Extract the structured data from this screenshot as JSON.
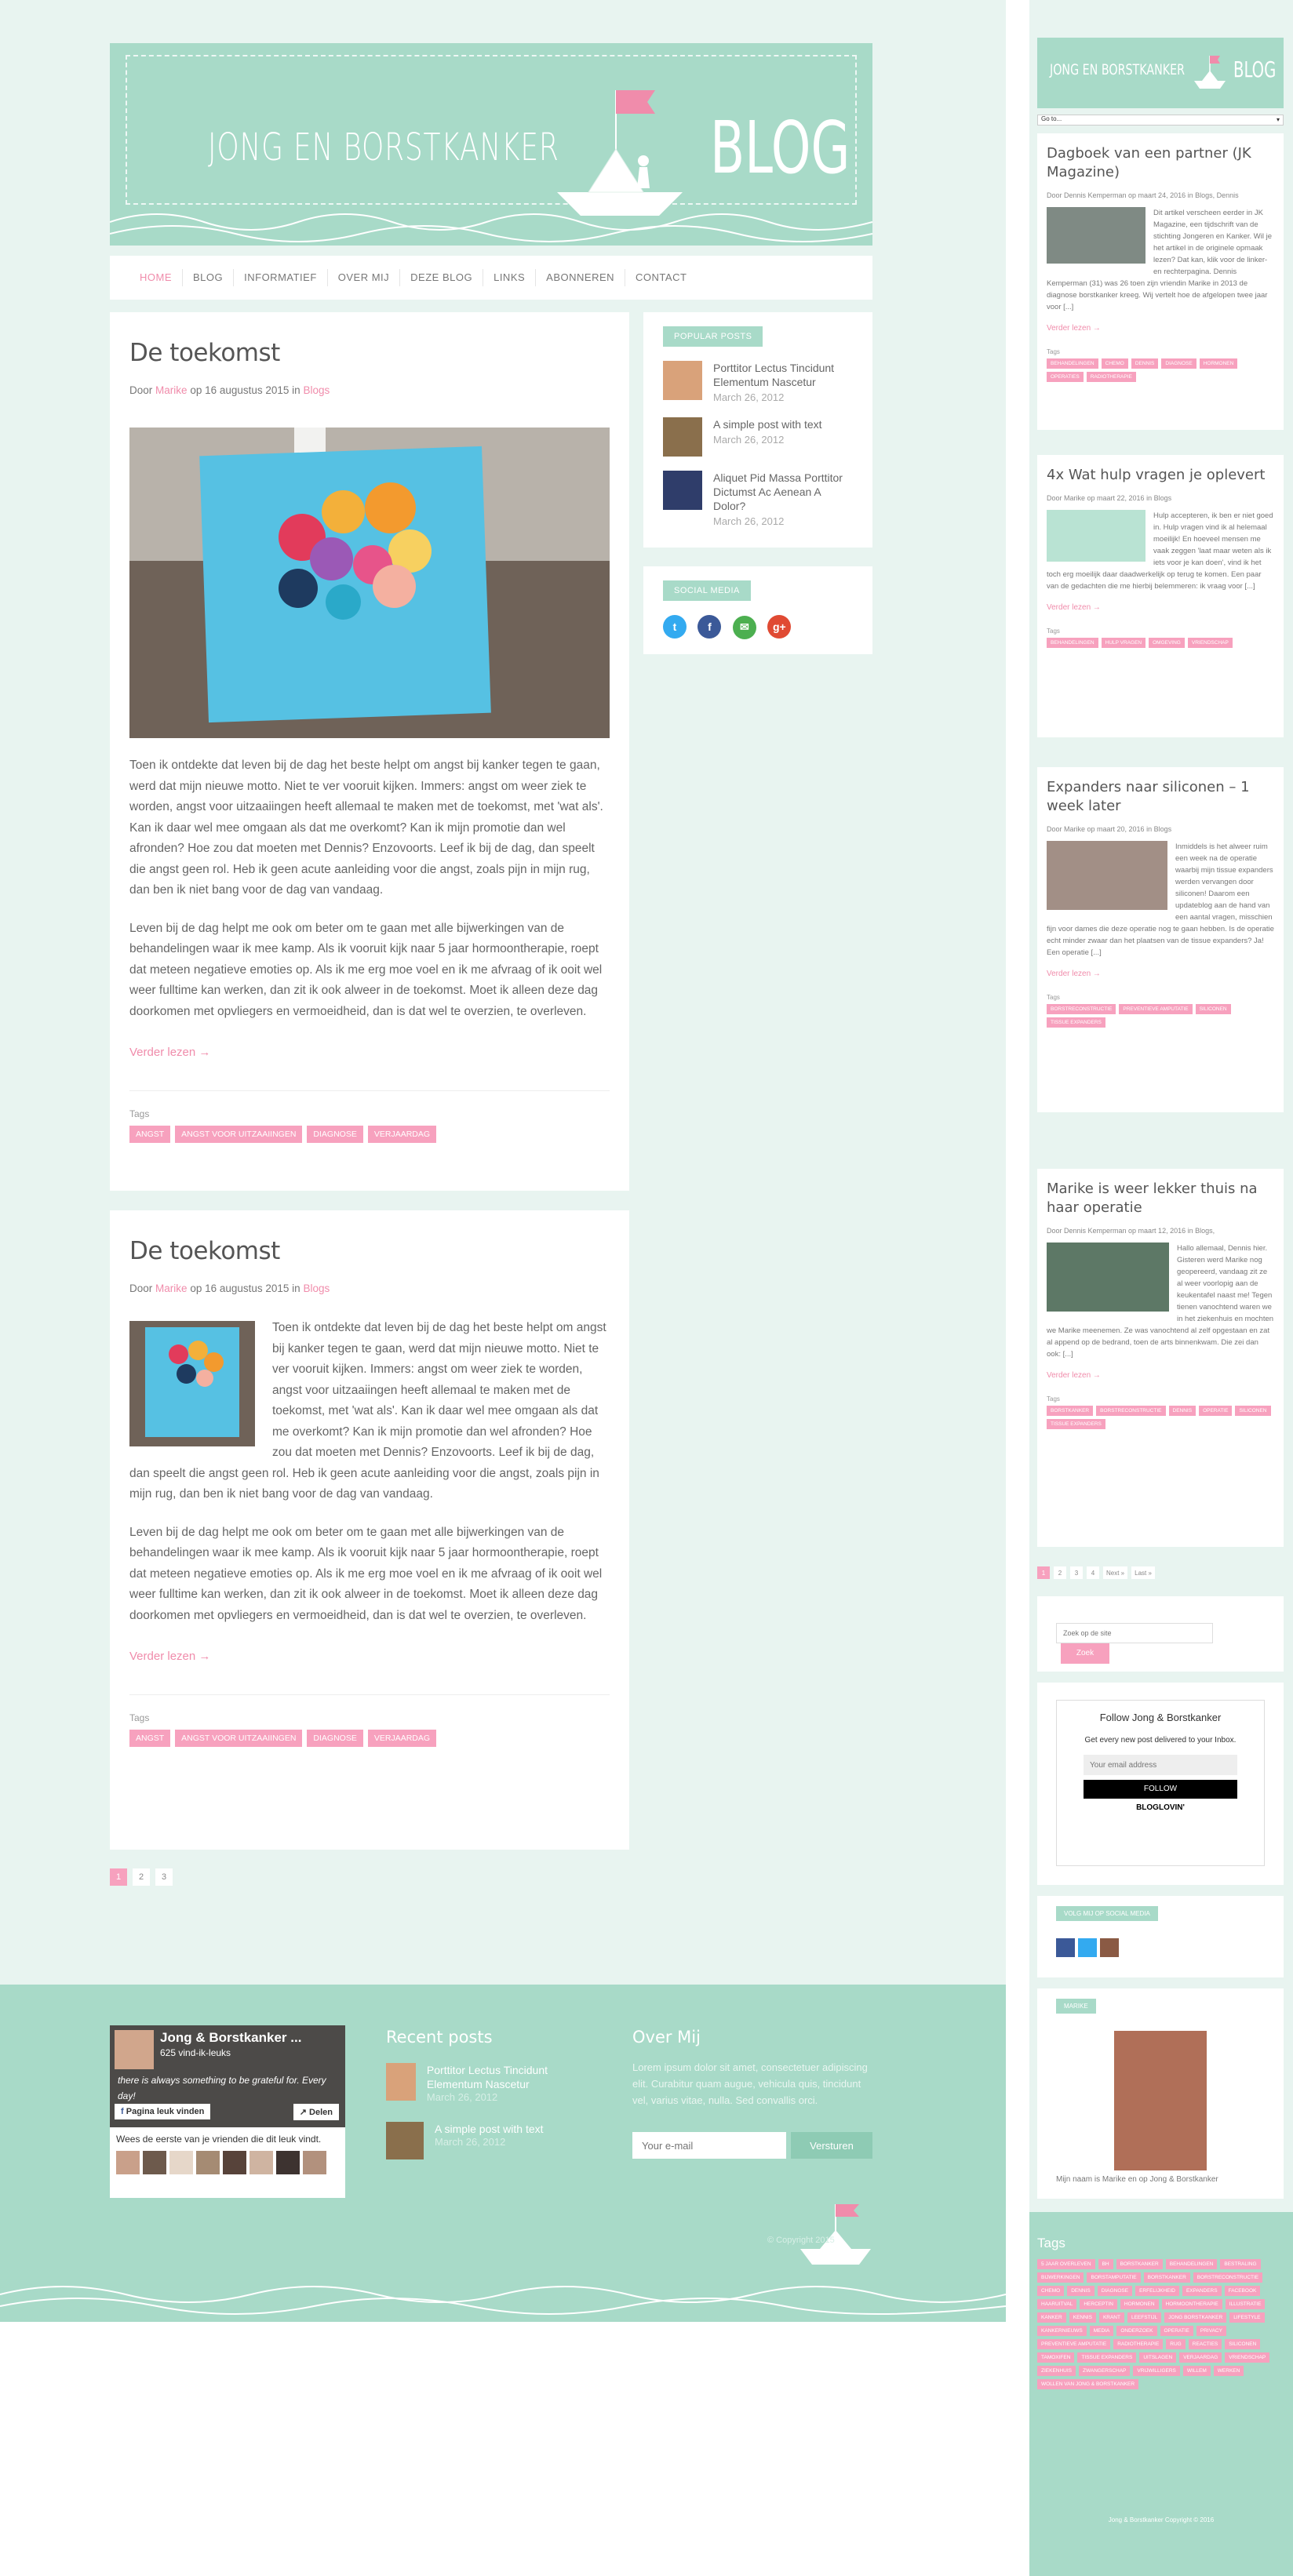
{
  "header": {
    "title": "JONG EN BORSTKANKER",
    "blog": "BLOG"
  },
  "nav": {
    "items": [
      "HOME",
      "BLOG",
      "INFORMATIEF",
      "OVER MIJ",
      "DEZE BLOG",
      "LINKS",
      "ABONNEREN",
      "CONTACT"
    ]
  },
  "posts": [
    {
      "title": "De toekomst",
      "meta_prefix": "Door",
      "author": "Marike",
      "meta_date": "op 16 augustus 2015 in",
      "category": "Blogs",
      "para1": "Toen ik ontdekte dat leven bij de dag het beste helpt om angst bij kanker tegen te gaan, werd dat mijn nieuwe motto. Niet te ver vooruit kijken. Immers: angst om weer ziek te worden, angst voor uitzaaiingen heeft allemaal te maken met de toekomst, met 'wat als'. Kan ik daar wel mee omgaan als dat me overkomt? Kan ik mijn promotie dan wel afronden? Hoe zou dat moeten met Dennis? Enzovoorts. Leef ik bij de dag, dan speelt die angst geen rol. Heb ik geen acute aanleiding voor die angst, zoals pijn in mijn rug, dan ben ik niet bang voor de dag van vandaag.",
      "para2": "Leven bij de dag helpt me ook om beter om te gaan met alle bijwerkingen van de behandelingen waar ik mee kamp. Als ik vooruit kijk naar 5 jaar hormoontherapie, roept dat meteen negatieve emoties op. Als ik me erg moe voel en ik me afvraag of ik ooit wel weer fulltime kan werken, dan zit ik ook alweer in de toekomst. Moet ik alleen deze dag doorkomen met opvliegers en vermoeidheid, dan is dat wel te overzien, te overleven.",
      "readmore": "Verder lezen →",
      "tags_label": "Tags",
      "tags": [
        "ANGST",
        "ANGST VOOR UITZAAIINGEN",
        "DIAGNOSE",
        "VERJAARDAG"
      ]
    },
    {
      "title": "De toekomst",
      "meta_prefix": "Door",
      "author": "Marike",
      "meta_date": "op 16 augustus 2015 in",
      "category": "Blogs",
      "para1": "Toen ik ontdekte dat leven bij de dag het beste helpt om angst bij kanker tegen te gaan, werd dat mijn nieuwe motto. Niet te ver vooruit kijken. Immers: angst om weer ziek te worden, angst voor uitzaaiingen heeft allemaal te maken met de toekomst, met 'wat als'. Kan ik daar wel mee omgaan als dat me overkomt? Kan ik mijn promotie dan wel afronden? Hoe zou dat moeten met Dennis? Enzovoorts. Leef ik bij de dag, dan speelt die angst geen rol. Heb ik geen acute aanleiding voor die angst, zoals pijn in mijn rug, dan ben ik niet bang voor de dag van vandaag.",
      "para2": "Leven bij de dag helpt me ook om beter om te gaan met alle bijwerkingen van de behandelingen waar ik mee kamp. Als ik vooruit kijk naar 5 jaar hormoontherapie, roept dat meteen negatieve emoties op. Als ik me erg moe voel en ik me afvraag of ik ooit wel weer fulltime kan werken, dan zit ik ook alweer in de toekomst. Moet ik alleen deze dag doorkomen met opvliegers en vermoeidheid, dan is dat wel te overzien, te overleven.",
      "readmore": "Verder lezen →",
      "tags_label": "Tags",
      "tags": [
        "ANGST",
        "ANGST VOOR UITZAAIINGEN",
        "DIAGNOSE",
        "VERJAARDAG"
      ]
    }
  ],
  "pager": [
    "1",
    "2",
    "3"
  ],
  "popular": {
    "label": "POPULAR POSTS",
    "items": [
      {
        "title": "Porttitor Lectus Tincidunt Elementum Nascetur",
        "date": "March 26, 2012",
        "color": "#d9a27a"
      },
      {
        "title": "A simple post with text",
        "date": "March 26, 2012",
        "color": "#8a6f4c"
      },
      {
        "title": "Aliquet Pid Massa Porttitor Dictumst Ac Aenean A Dolor?",
        "date": "March 26, 2012",
        "color": "#2f3d6a"
      }
    ]
  },
  "social": {
    "label": "SOCIAL MEDIA",
    "icons": [
      {
        "name": "twitter-icon",
        "glyph": "t",
        "color": "#33aaf0"
      },
      {
        "name": "facebook-icon",
        "glyph": "f",
        "color": "#3b5998"
      },
      {
        "name": "email-icon",
        "glyph": "✉",
        "color": "#4caf50"
      },
      {
        "name": "googleplus-icon",
        "glyph": "g+",
        "color": "#e04a33"
      }
    ]
  },
  "footer": {
    "fb_name": "Jong & Borstkanker ...",
    "fb_likes": "625 vind-ik-leuks",
    "fb_quote": "there is always something to be grateful for. Every day!",
    "fb_like_btn": "Pagina leuk vinden",
    "fb_share": "Delen",
    "fb_friends": "Wees de eerste van je vrienden die dit leuk vindt.",
    "recent_title": "Recent posts",
    "recent": [
      {
        "title": "Porttitor Lectus Tincidunt Elementum Nascetur",
        "date": "March 26, 2012"
      },
      {
        "title": "A simple post with text",
        "date": "March 26, 2012"
      }
    ],
    "about_title": "Over Mij",
    "about_text": "Lorem ipsum dolor sit amet, consectetuer adipiscing elit. Curabitur quam augue, vehicula quis, tincidunt vel, varius vitae, nulla. Sed convallis orci.",
    "email_placeholder": "Your e-mail",
    "send": "Versturen",
    "copyright": "© Copyright 2015"
  },
  "right": {
    "goto": "Go to...",
    "cards": [
      {
        "title": "Dagboek van een partner (JK Magazine)",
        "meta": "Door Dennis Kemperman op maart 24, 2016 in Blogs, Dennis",
        "text": "Dit artikel verscheen eerder in JK Magazine, een tijdschrift van de stichting Jongeren en Kanker. Wil je het artikel in de originele opmaak lezen? Dat kan, klik voor de linker- en rechterpagina. Dennis Kemperman (31) was 26 toen zijn vriendin Marike in 2013 de diagnose borstkanker kreeg. Wij vertelt hoe de afgelopen twee jaar voor [...]",
        "tags": [
          "BEHANDELINGEN",
          "CHEMO",
          "DENNIS",
          "DIAGNOSE",
          "HORMONEN",
          "OPERATIES",
          "RADIOTHERAPIE"
        ]
      },
      {
        "title": "4x Wat hulp vragen je oplevert",
        "meta": "Door Marike op maart 22, 2016 in Blogs",
        "text": "Hulp accepteren, ik ben er niet goed in. Hulp vragen vind ik al helemaal moeilijk! En hoeveel mensen me vaak zeggen 'laat maar weten als ik iets voor je kan doen', vind ik het toch erg moeilijk daar daadwerkelijk op terug te komen. Een paar van de gedachten die me hierbij belemmeren: ik vraag voor [...]",
        "tags": [
          "BEHANDELINGEN",
          "HULP VRAGEN",
          "OMGEVING",
          "VRIENDSCHAP"
        ]
      },
      {
        "title": "Expanders naar siliconen – 1 week later",
        "meta": "Door Marike op maart 20, 2016 in Blogs",
        "text": "Inmiddels is het alweer ruim een week na de operatie waarbij mijn tissue expanders werden vervangen door siliconen! Daarom een updateblog aan de hand van een aantal vragen, misschien fijn voor dames die deze operatie nog te gaan hebben. Is de operatie echt minder zwaar dan het plaatsen van de tissue expanders? Ja! Een operatie [...]",
        "tags": [
          "BORSTRECONSTRUCTIE",
          "PREVENTIEVE AMPUTATIE",
          "SILICONEN",
          "TISSUE EXPANDERS"
        ]
      },
      {
        "title": "Marike is weer lekker thuis na haar operatie",
        "meta": "Door Dennis Kemperman op maart 12, 2016 in Blogs,",
        "text": "Hallo allemaal, Dennis hier. Gisteren werd Marike nog geopereerd, vandaag zit ze al weer voorlopig aan de keukentafel naast me! Tegen tienen vanochtend waren we in het ziekenhuis en mochten we Marike meenemen. Ze was vanochtend al zelf opgestaan en zat al append op de bedrand, toen de arts binnenkwam. Die zei dan ook: [...]",
        "tags": [
          "BORSTKANKER",
          "BORSTRECONSTRUCTIE",
          "DENNIS",
          "OPERATIE",
          "SILICONEN",
          "TISSUE EXPANDERS"
        ]
      }
    ],
    "readmore": "Verder lezen →",
    "tags_label": "Tags",
    "pager": [
      "1",
      "2",
      "3",
      "4",
      "Next »",
      "Last »"
    ],
    "search_placeholder": "Zoek op de site",
    "search_btn": "Zoek",
    "bloglovin": {
      "title": "Follow Jong & Borstkanker",
      "sub": "Get every new post delivered to your Inbox.",
      "placeholder": "Your email address",
      "btn": "FOLLOW",
      "brand": "BLOGLOVIN'"
    },
    "social_label": "VOLG MIJ OP SOCIAL MEDIA",
    "marike_label": "MARIKE",
    "marike_text": "Mijn naam is Marike en op Jong & Borstkanker",
    "tags_title": "Tags",
    "tagcloud": [
      "5 JAAR OVERLEVEN",
      "BH",
      "BORSTKANKER",
      "BEHANDELINGEN",
      "BESTRALING",
      "BIJWERKINGEN",
      "BORSTAMPUTATIE",
      "BORSTKANKER",
      "BORSTRECONSTRUCTIE",
      "CHEMO",
      "DENNIS",
      "DIAGNOSE",
      "ERFELIJKHEID",
      "EXPANDERS",
      "FACEBOOK",
      "HAARUITVAL",
      "HERCEPTIN",
      "HORMONEN",
      "HORMOONTHERAPIE",
      "ILLUSTRATIE",
      "KANKER",
      "KENNIS",
      "KRANT",
      "LEEFSTIJL",
      "JONG BORSTKANKER",
      "LIFESTYLE",
      "KANKERNIEUWS",
      "MEDIA",
      "ONDERZOEK",
      "OPERATIE",
      "PRIVACY",
      "PREVENTIEVE AMPUTATIE",
      "RADIOTHERAPIE",
      "RUG",
      "REACTIES",
      "SILICONEN",
      "TAMOXIFEN",
      "TISSUE EXPANDERS",
      "UITSLAGEN",
      "VERJAARDAG",
      "VRIENDSCHAP",
      "ZIEKENHUIS",
      "ZWANGERSCHAP",
      "VRIJWILLIGERS",
      "WILLEM",
      "WERKEN",
      "WOLLEN VAN JONG & BORSTKANKER"
    ],
    "copyright": "Jong & Borstkanker Copyright © 2016"
  }
}
